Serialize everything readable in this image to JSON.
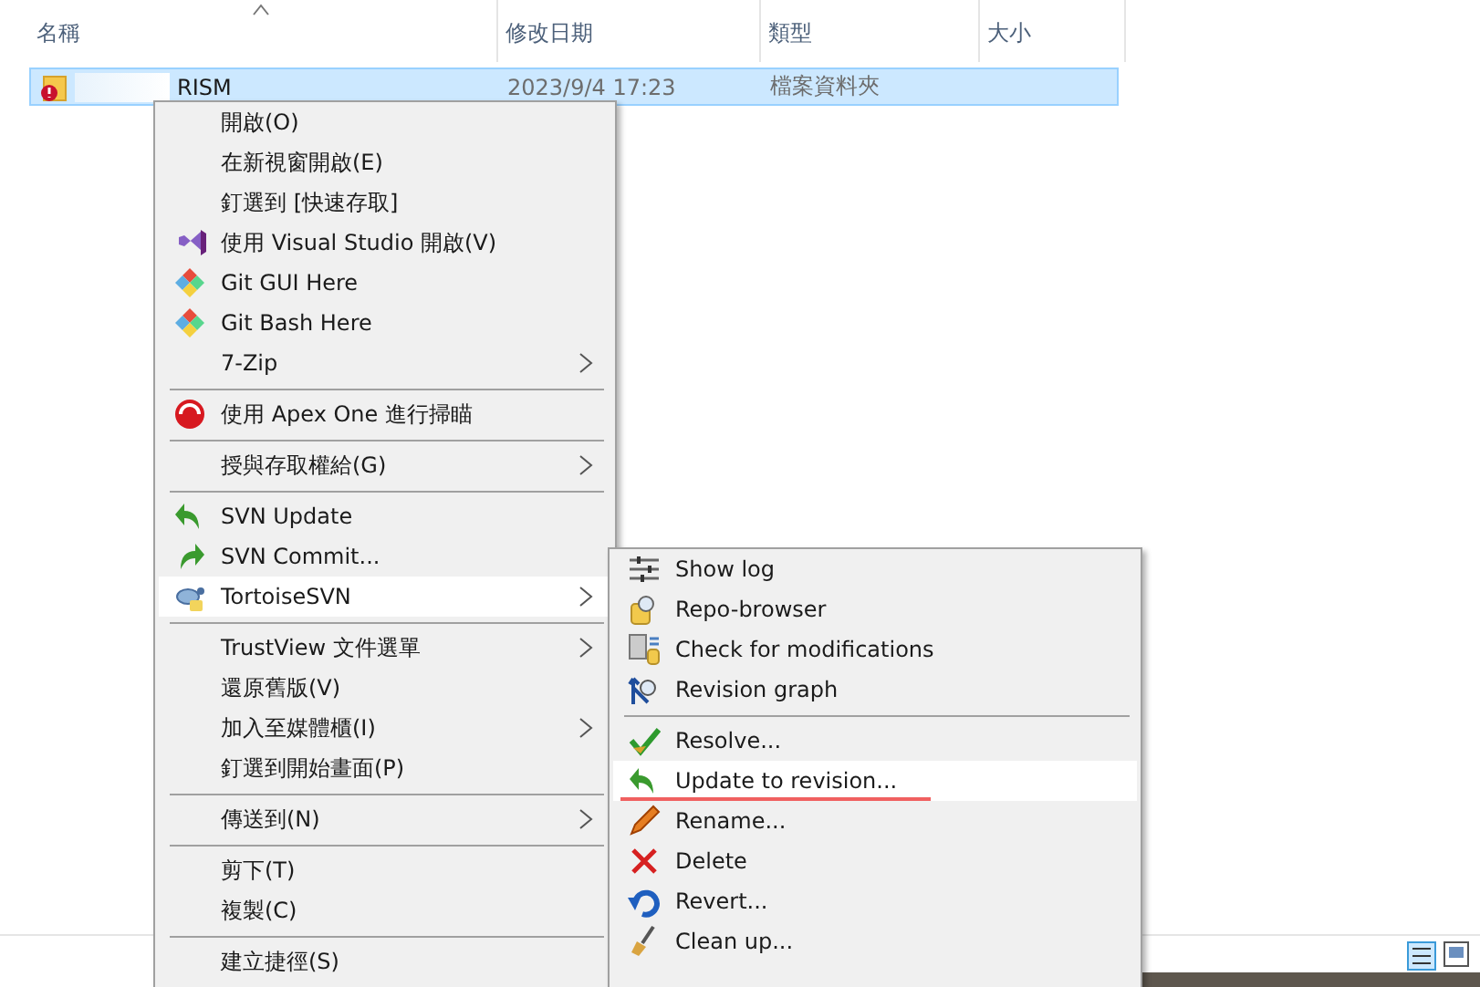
{
  "file_list": {
    "columns": [
      {
        "label": "名稱",
        "sorted": true
      },
      {
        "label": "修改日期",
        "sorted": false
      },
      {
        "label": "類型",
        "sorted": false
      },
      {
        "label": "大小",
        "sorted": false
      }
    ],
    "rows": [
      {
        "name": "RISM",
        "modified": "2023/9/4 17:23",
        "type": "檔案資料夾",
        "selected": true
      }
    ]
  },
  "context_menu": {
    "items": [
      {
        "kind": "item",
        "label": "開啟(O)",
        "has_submenu": false,
        "selected": false
      },
      {
        "kind": "item",
        "label": "在新視窗開啟(E)",
        "has_submenu": false,
        "selected": false
      },
      {
        "kind": "item",
        "label": "釘選到 [快速存取]",
        "has_submenu": false,
        "selected": false
      },
      {
        "kind": "item",
        "label": "使用 Visual Studio 開啟(V)",
        "has_submenu": false,
        "selected": false
      },
      {
        "kind": "item",
        "label": "Git GUI Here",
        "has_submenu": false,
        "selected": false
      },
      {
        "kind": "item",
        "label": "Git Bash Here",
        "has_submenu": false,
        "selected": false
      },
      {
        "kind": "item",
        "label": "7-Zip",
        "has_submenu": true,
        "selected": false
      },
      {
        "kind": "separator"
      },
      {
        "kind": "item",
        "label": "使用 Apex One 進行掃瞄",
        "has_submenu": false,
        "selected": false
      },
      {
        "kind": "separator"
      },
      {
        "kind": "item",
        "label": "授與存取權給(G)",
        "has_submenu": true,
        "selected": false
      },
      {
        "kind": "separator"
      },
      {
        "kind": "item",
        "label": "SVN Update",
        "has_submenu": false,
        "selected": false
      },
      {
        "kind": "item",
        "label": "SVN Commit...",
        "has_submenu": false,
        "selected": false
      },
      {
        "kind": "item",
        "label": "TortoiseSVN",
        "has_submenu": true,
        "selected": true
      },
      {
        "kind": "separator"
      },
      {
        "kind": "item",
        "label": "TrustView 文件選單",
        "has_submenu": true,
        "selected": false
      },
      {
        "kind": "item",
        "label": "還原舊版(V)",
        "has_submenu": false,
        "selected": false
      },
      {
        "kind": "item",
        "label": "加入至媒體櫃(I)",
        "has_submenu": true,
        "selected": false
      },
      {
        "kind": "item",
        "label": "釘選到開始畫面(P)",
        "has_submenu": false,
        "selected": false
      },
      {
        "kind": "separator"
      },
      {
        "kind": "item",
        "label": "傳送到(N)",
        "has_submenu": true,
        "selected": false
      },
      {
        "kind": "separator"
      },
      {
        "kind": "item",
        "label": "剪下(T)",
        "has_submenu": false,
        "selected": false
      },
      {
        "kind": "item",
        "label": "複製(C)",
        "has_submenu": false,
        "selected": false
      },
      {
        "kind": "separator"
      },
      {
        "kind": "item",
        "label": "建立捷徑(S)",
        "has_submenu": false,
        "selected": false
      }
    ]
  },
  "submenu": {
    "items": [
      {
        "kind": "item",
        "label": "Show log",
        "selected": false,
        "underlined": false
      },
      {
        "kind": "item",
        "label": "Repo-browser",
        "selected": false,
        "underlined": false
      },
      {
        "kind": "item",
        "label": "Check for modifications",
        "selected": false,
        "underlined": false
      },
      {
        "kind": "item",
        "label": "Revision graph",
        "selected": false,
        "underlined": false
      },
      {
        "kind": "separator"
      },
      {
        "kind": "item",
        "label": "Resolve...",
        "selected": false,
        "underlined": false
      },
      {
        "kind": "item",
        "label": "Update to revision...",
        "selected": true,
        "underlined": true
      },
      {
        "kind": "item",
        "label": "Rename...",
        "selected": false,
        "underlined": false
      },
      {
        "kind": "item",
        "label": "Delete",
        "selected": false,
        "underlined": false
      },
      {
        "kind": "item",
        "label": "Revert...",
        "selected": false,
        "underlined": false
      },
      {
        "kind": "item",
        "label": "Clean up...",
        "selected": false,
        "underlined": false
      }
    ]
  }
}
